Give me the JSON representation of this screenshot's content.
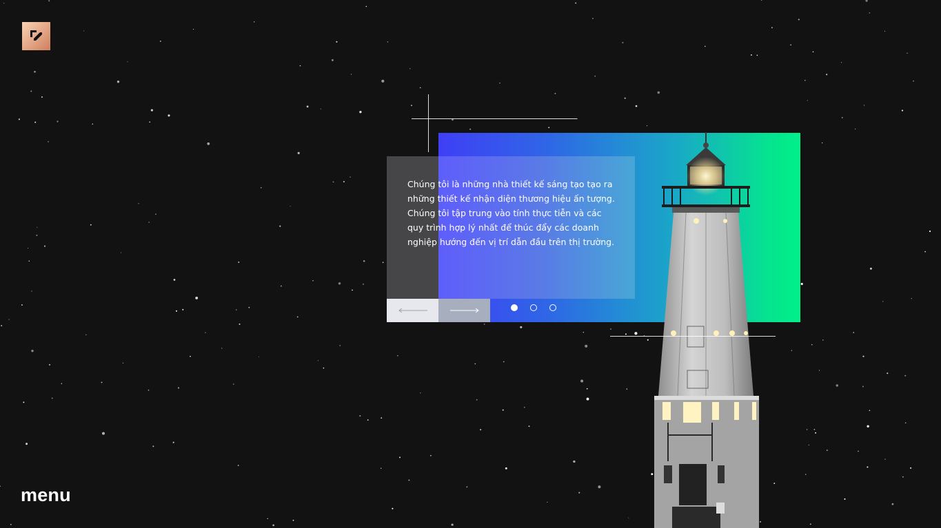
{
  "brand": {
    "logo_icon": "brand-logo-icon",
    "logo_colors": [
      "#f7c9a8",
      "#d68a68"
    ]
  },
  "nav": {
    "menu_label": "menu"
  },
  "hero": {
    "intro_text": "Chúng tôi là những nhà thiết kế sáng tạo tạo ra những thiết kế nhận diện thương hiệu ấn tượng. Chúng tôi tập trung vào tính thực tiễn và các quy trình hợp lý nhất để thúc đẩy các doanh nghiệp hướng đến vị trí dẫn đầu trên thị trường.",
    "gradient_colors": [
      "#3f3ff5",
      "#00f08a"
    ]
  },
  "slider": {
    "prev_icon": "arrow-left-icon",
    "next_icon": "arrow-right-icon",
    "total_slides": 3,
    "active_slide": 1
  },
  "colors": {
    "background": "#121213",
    "text": "#ffffff"
  }
}
